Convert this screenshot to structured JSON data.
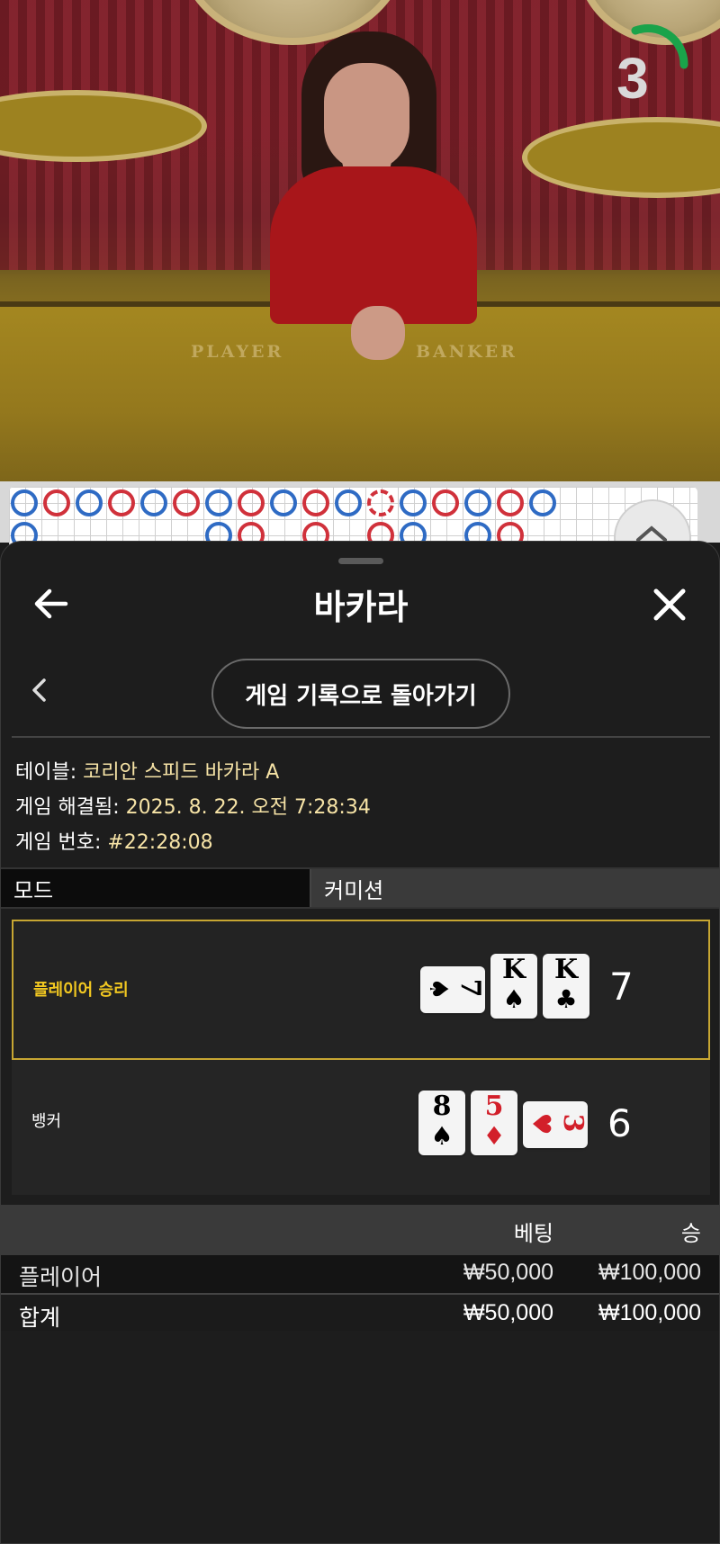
{
  "video": {
    "countdown": "3",
    "felt_left": "PLAYER",
    "felt_right": "BANKER",
    "countdown_color": "#1aa34a"
  },
  "roadmap": {
    "top_row": [
      "P",
      "B",
      "P",
      "B",
      "P",
      "B",
      "P",
      "B",
      "P",
      "B",
      "P",
      "B",
      "P",
      "B",
      "P",
      "B",
      "P"
    ],
    "colors": {
      "player": "#2f6bc4",
      "banker": "#d0313b"
    }
  },
  "sheet": {
    "title": "바카라",
    "back_icon": "arrow-left-icon",
    "close_icon": "close-icon",
    "return_button": "게임 기록으로 돌아가기",
    "info": {
      "table_label": "테이블:",
      "table_value": "코리안 스피드 바카라 A",
      "resolved_label": "게임 해결됨:",
      "resolved_value": "2025. 8. 22. 오전 7:28:34",
      "game_no_label": "게임 번호:",
      "game_no_value": "#22:28:08"
    },
    "tabs": {
      "mode": "모드",
      "commission": "커미션"
    },
    "results": {
      "player": {
        "label": "플레이어 승리",
        "score": "7",
        "cards": [
          {
            "rank": "7",
            "suit": "♠",
            "sideways": true
          },
          {
            "rank": "K",
            "suit": "♠",
            "sideways": false
          },
          {
            "rank": "K",
            "suit": "♣",
            "sideways": false
          }
        ]
      },
      "banker": {
        "label": "뱅커",
        "score": "6",
        "cards": [
          {
            "rank": "8",
            "suit": "♠",
            "sideways": false
          },
          {
            "rank": "5",
            "suit": "♦",
            "sideways": false
          },
          {
            "rank": "3",
            "suit": "♥",
            "sideways": true
          }
        ]
      }
    },
    "bets": {
      "header_bet": "베팅",
      "header_win": "승",
      "rows": [
        {
          "name": "플레이어",
          "bet": "₩50,000",
          "win": "₩100,000"
        },
        {
          "name": "합계",
          "bet": "₩50,000",
          "win": "₩100,000"
        }
      ]
    },
    "accent": "#c7a632",
    "win_label_color": "#f2c821"
  }
}
